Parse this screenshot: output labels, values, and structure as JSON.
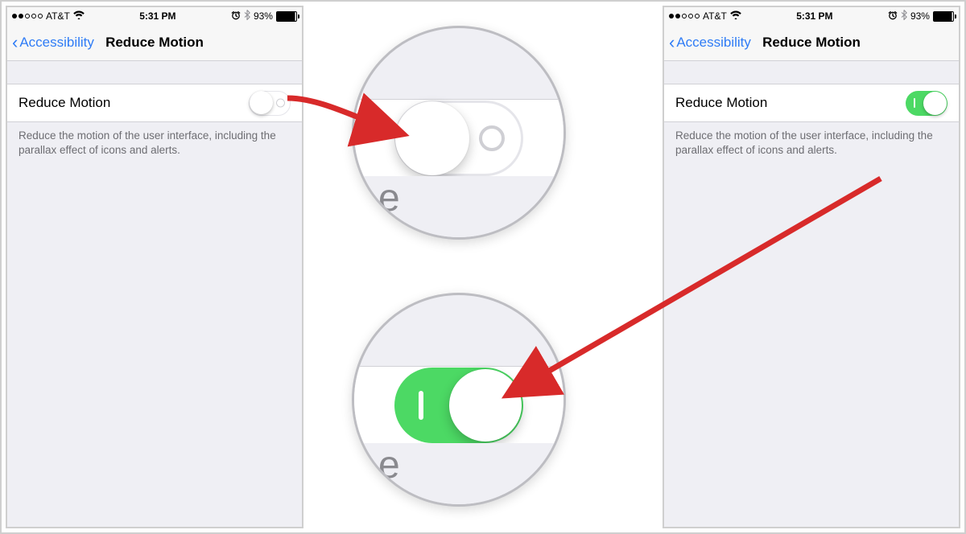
{
  "status": {
    "carrier": "AT&T",
    "time": "5:31 PM",
    "battery_pct": "93%"
  },
  "nav": {
    "back_label": "Accessibility",
    "title": "Reduce Motion"
  },
  "setting": {
    "label": "Reduce Motion",
    "footer": "Reduce the motion of the user interface, including the parallax effect of icons and alerts."
  },
  "colors": {
    "ios_blue": "#2f7cf6",
    "ios_green": "#4cd964",
    "arrow_red": "#d82a2a"
  }
}
